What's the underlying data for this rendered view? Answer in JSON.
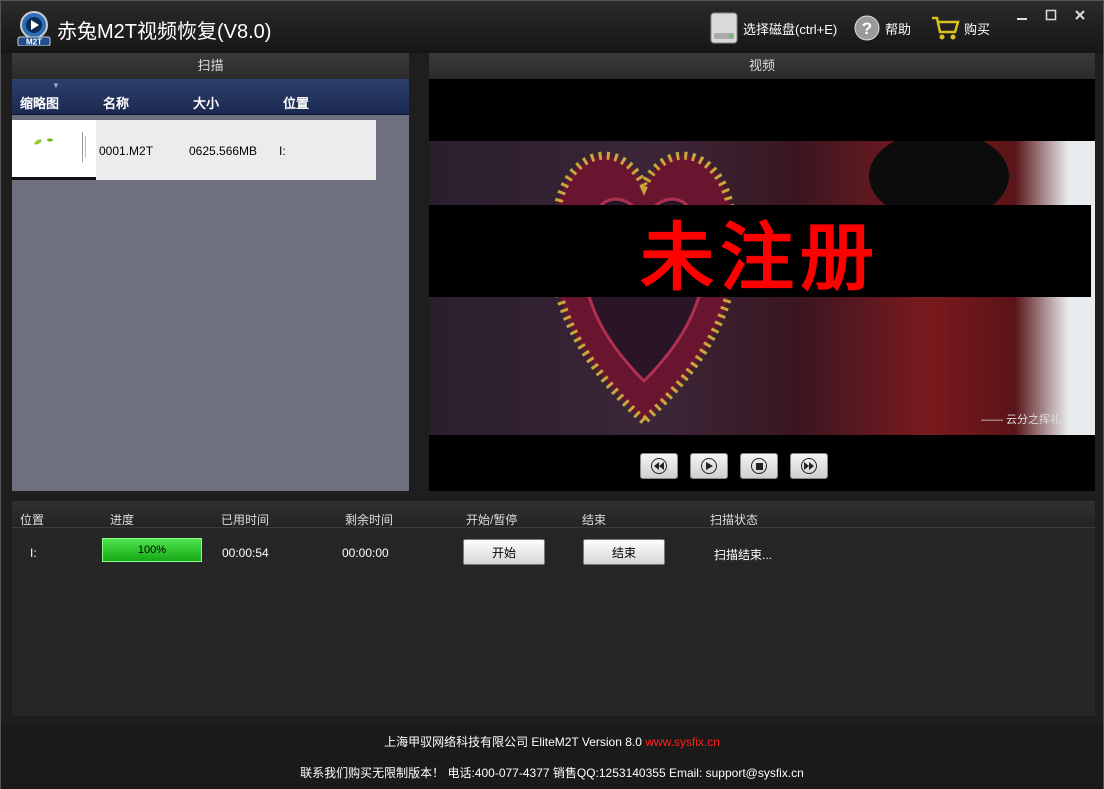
{
  "app": {
    "title": "赤兔M2T视频恢复(V8.0)",
    "logo_text": "M2T"
  },
  "toolbar": {
    "select_disk": "选择磁盘(ctrl+E)",
    "help": "帮助",
    "buy": "购买"
  },
  "panels": {
    "scan_title": "扫描",
    "video_title": "视频"
  },
  "file_list": {
    "columns": [
      "缩略图",
      "名称",
      "大小",
      "位置"
    ],
    "rows": [
      {
        "name": "0001.M2T",
        "size": "0625.566MB",
        "location": "I:"
      }
    ]
  },
  "video": {
    "watermark": "未注册",
    "small_caption": "—— 云分之挥礼"
  },
  "tasks": {
    "columns": [
      "位置",
      "进度",
      "已用时间",
      "剩余时间",
      "开始/暂停",
      "结束",
      "扫描状态"
    ],
    "row": {
      "location": "I:",
      "progress_label": "100%",
      "progress": 1.0,
      "elapsed": "00:00:54",
      "remaining": "00:00:00",
      "start_label": "开始",
      "end_label": "结束",
      "status": "扫描结束..."
    }
  },
  "footer": {
    "company": "上海甲驭网络科技有限公司 EliteM2T Version 8.0",
    "site": "www.sysfix.cn",
    "contact": "联系我们购买无限制版本！ 电话:400-077-4377 销售QQ:1253140355 Email: support@sysfix.cn"
  },
  "colors": {
    "accent_blue": "#1c2a50",
    "progress_green": "#16a816",
    "watermark_red": "#ff0000"
  }
}
